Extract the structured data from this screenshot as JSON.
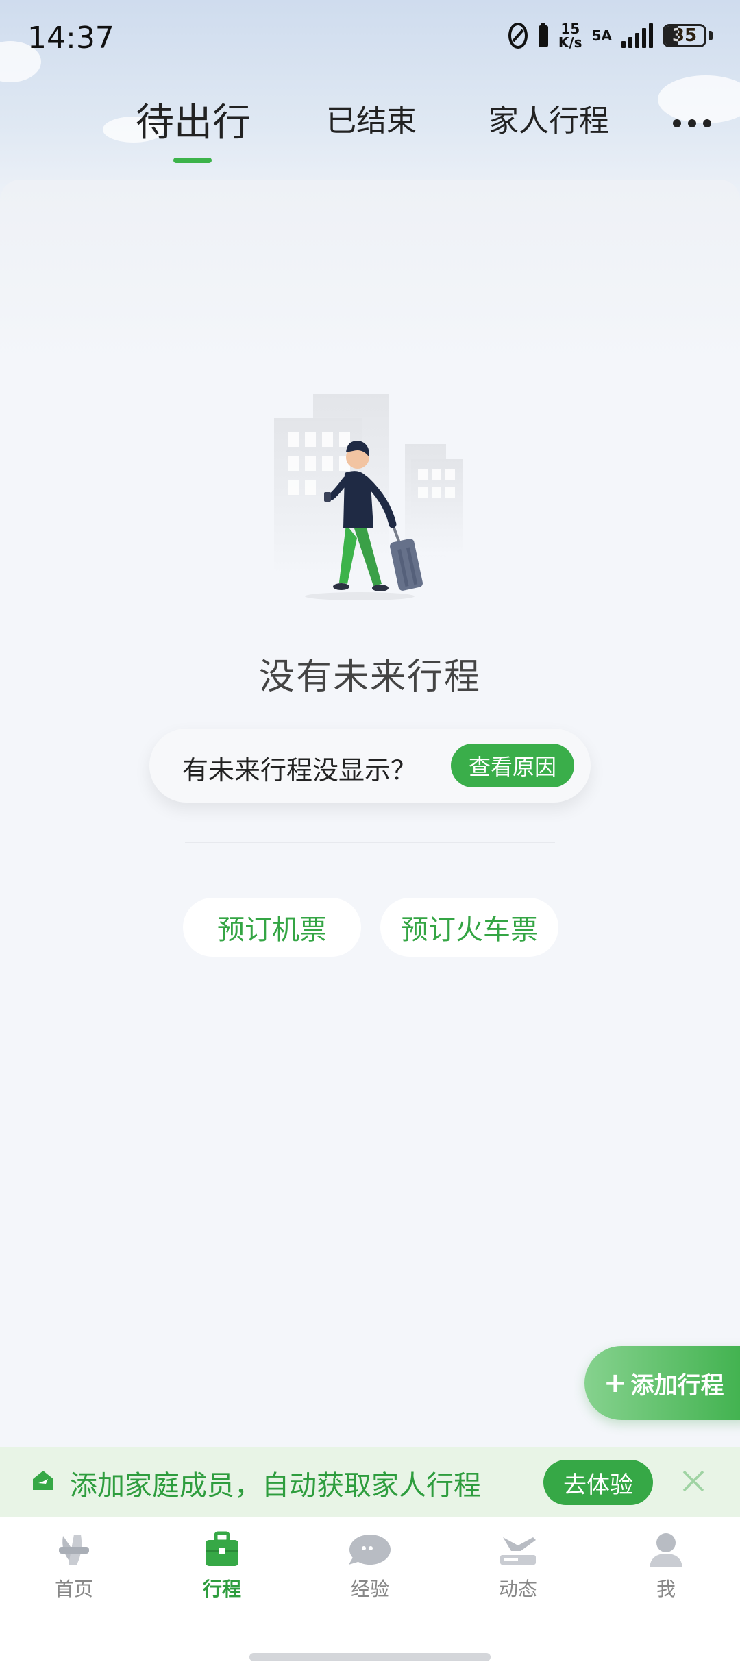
{
  "status_bar": {
    "time": "14:37",
    "speed_value": "15",
    "speed_unit": "K/s",
    "network": "5A",
    "battery": "35"
  },
  "tabs": [
    {
      "label": "待出行",
      "active": true
    },
    {
      "label": "已结束",
      "active": false
    },
    {
      "label": "家人行程",
      "active": false
    }
  ],
  "empty": {
    "title": "没有未来行程",
    "hint": "有未来行程没显示？",
    "hint_button": "查看原因"
  },
  "booking": {
    "flight": "预订机票",
    "train": "预订火车票"
  },
  "add_trip": "添加行程",
  "family_banner": {
    "text": "添加家庭成员，自动获取家人行程",
    "button": "去体验"
  },
  "bottom_nav": [
    {
      "label": "首页",
      "icon": "home-icon"
    },
    {
      "label": "行程",
      "icon": "suitcase-icon",
      "active": true
    },
    {
      "label": "经验",
      "icon": "chat-bubble-icon"
    },
    {
      "label": "动态",
      "icon": "plane-feed-icon"
    },
    {
      "label": "我",
      "icon": "user-icon"
    }
  ],
  "colors": {
    "accent": "#3aae4a",
    "background": "#f3f5f9",
    "banner_bg": "#e8f4e6"
  }
}
